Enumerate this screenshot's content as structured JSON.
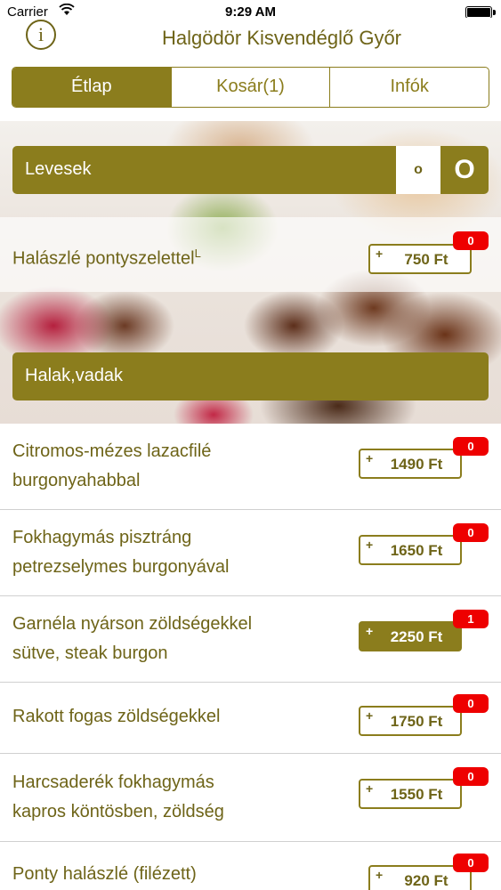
{
  "status_bar": {
    "carrier": "Carrier",
    "time": "9:29 AM"
  },
  "header": {
    "info_glyph": "i",
    "title": "Halgödör Kisvendéglő Győr"
  },
  "tabs": [
    {
      "label": "Étlap",
      "active": true
    },
    {
      "label": "Kosár(1)",
      "active": false
    },
    {
      "label": "Infók",
      "active": false
    }
  ],
  "categories": [
    {
      "label": "Levesek",
      "toggle_small": "o",
      "toggle_large": "O"
    },
    {
      "label": "Halak,vadak"
    }
  ],
  "dishes": [
    {
      "line1": "Halászlé pontyszelettel",
      "line2": "",
      "suffix": "L",
      "price": "750 Ft",
      "qty": "0",
      "selected": false
    },
    {
      "line1": "Citromos-mézes lazacfilé",
      "line2": "burgonyahabbal",
      "price": "1490 Ft",
      "qty": "0",
      "selected": false
    },
    {
      "line1": "Fokhagymás pisztráng",
      "line2": "petrezselymes burgonyával",
      "price": "1650 Ft",
      "qty": "0",
      "selected": false
    },
    {
      "line1": "Garnéla nyárson zöldségekkel",
      "line2": "sütve, steak burgon",
      "price": "2250 Ft",
      "qty": "1",
      "selected": true
    },
    {
      "line1": "Rakott fogas zöldségekkel",
      "line2": "",
      "price": "1750 Ft",
      "qty": "0",
      "selected": false
    },
    {
      "line1": "Harcsaderék fokhagymás",
      "line2": "kapros köntösben, zöldség",
      "price": "1550 Ft",
      "qty": "0",
      "selected": false
    },
    {
      "line1": "Ponty halászlé (filézett)",
      "line2": "",
      "price": "920 Ft",
      "qty": "0",
      "selected": false
    }
  ],
  "price_plus_glyph": "+",
  "colors": {
    "accent": "#8b7d1d",
    "text": "#6e6418",
    "badge": "#ee0000"
  }
}
